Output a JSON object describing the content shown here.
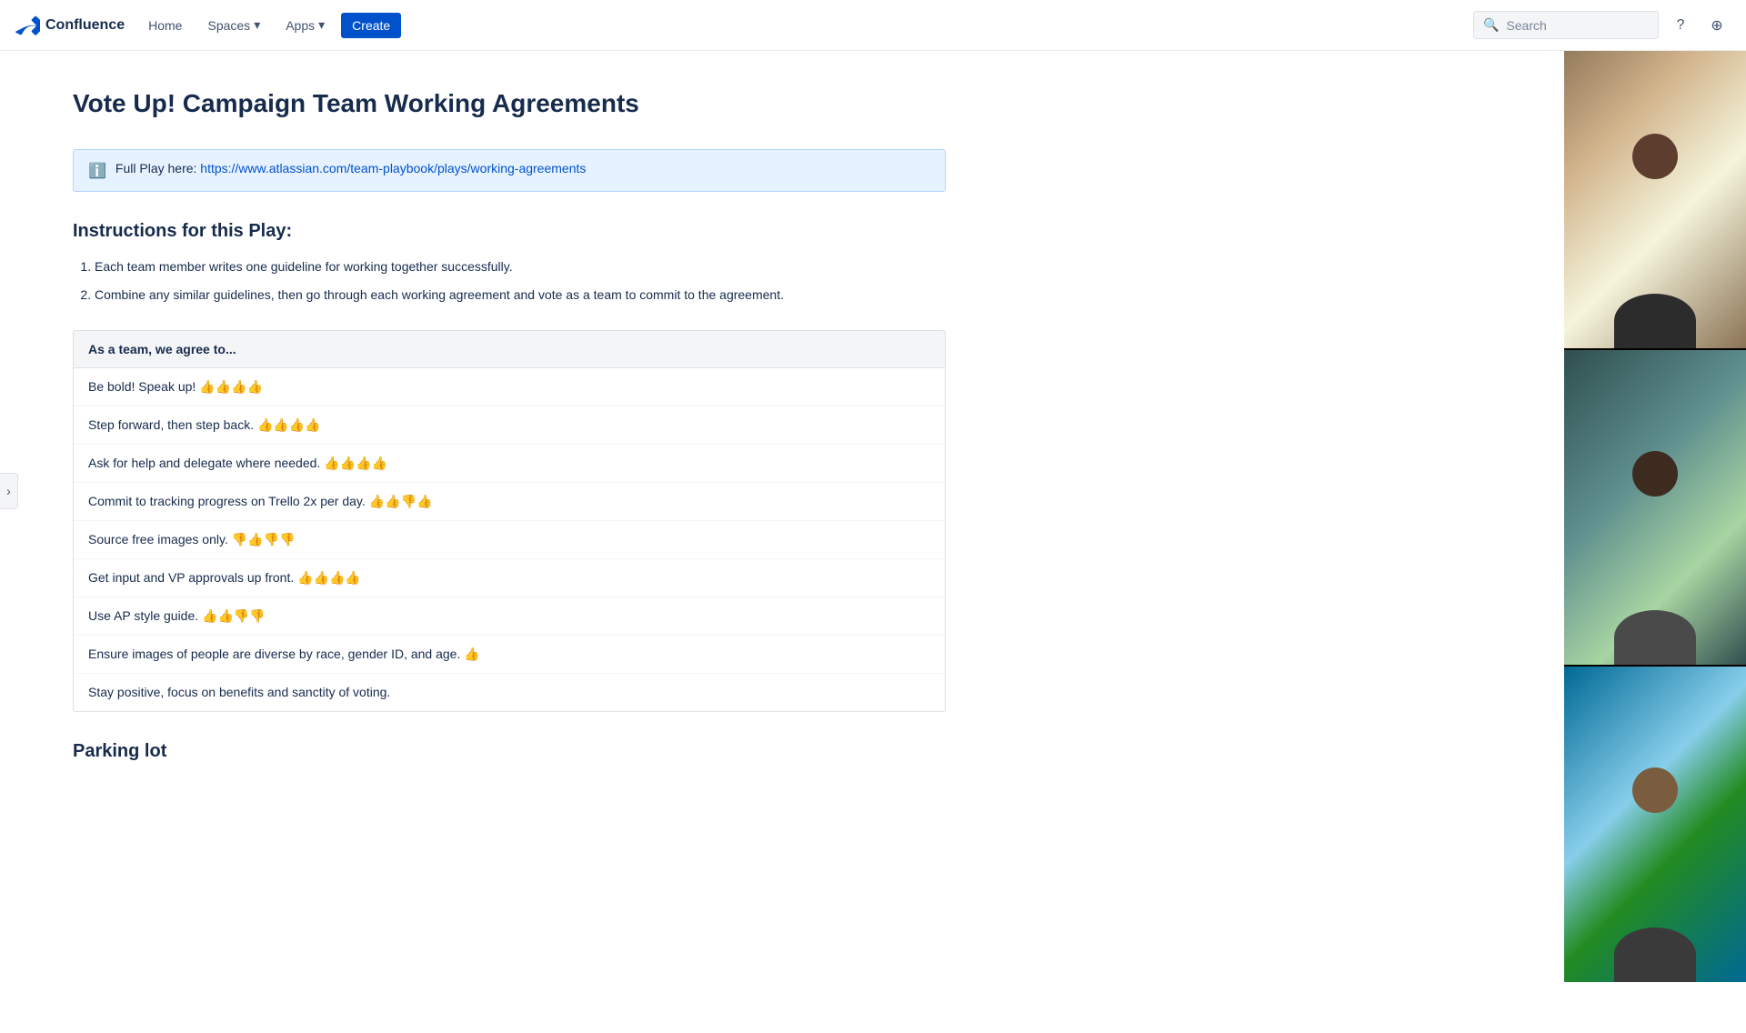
{
  "nav": {
    "logo_text": "Confluence",
    "home_label": "Home",
    "spaces_label": "Spaces",
    "apps_label": "Apps",
    "create_label": "Create",
    "search_placeholder": "Search"
  },
  "page": {
    "title": "Vote Up! Campaign Team Working Agreements",
    "info_banner": {
      "prefix": "Full Play here: ",
      "link_text": "https://www.atlassian.com/team-playbook/plays",
      "link_suffix": "/working-agreements"
    },
    "instructions_title": "Instructions for this Play:",
    "instructions": [
      "Each team member writes one guideline for working together successfully.",
      "Combine any similar guidelines, then go through each working agreement and vote as a team to commit to the agreement."
    ],
    "agreements_header": "As a team, we agree to...",
    "agreements": [
      "Be bold! Speak up! 👍👍👍👍",
      "Step forward, then step back. 👍👍👍👍",
      "Ask for help and delegate where needed. 👍👍👍👍",
      "Commit to tracking progress on Trello 2x per day. 👍👍👎👍",
      "Source free images only. 👎👍👎👎",
      "Get input and VP approvals up front. 👍👍👍👍",
      "Use AP style guide. 👍👍👎👎",
      "Ensure images of people are diverse by race, gender ID, and age. 👍",
      "Stay positive, focus on benefits and sanctity of voting."
    ],
    "parking_lot_title": "Parking lot"
  },
  "sidebar_toggle": "›",
  "icons": {
    "search": "🔍",
    "help": "?",
    "user": "👤",
    "info": "ℹ"
  }
}
